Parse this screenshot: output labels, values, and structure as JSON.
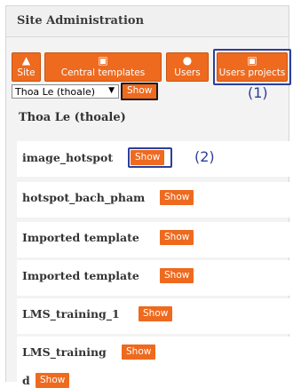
{
  "title": "Site Administration",
  "toolbar": {
    "site": "Site",
    "central_templates": "Central templates",
    "users": "Users",
    "users_projects": "Users projects"
  },
  "user_select": {
    "value": "Thoa Le (thoale)",
    "show_label": "Show"
  },
  "annotations": {
    "one": "(1)",
    "two": "(2)"
  },
  "user_heading": "Thoa Le (thoale)",
  "projects": [
    {
      "name": "image_hotspot",
      "action": "Show"
    },
    {
      "name": "hotspot_bach_pham",
      "action": "Show"
    },
    {
      "name": "Imported template",
      "action": "Show"
    },
    {
      "name": "Imported template",
      "action": "Show"
    },
    {
      "name": "LMS_training_1",
      "action": "Show"
    },
    {
      "name": "LMS_training",
      "action": "Show"
    },
    {
      "name": "d",
      "action": "Show"
    }
  ],
  "colors": {
    "accent": "#ee6a1f",
    "highlight_border": "#2d3e9c",
    "panel": "#f3f3f3"
  }
}
